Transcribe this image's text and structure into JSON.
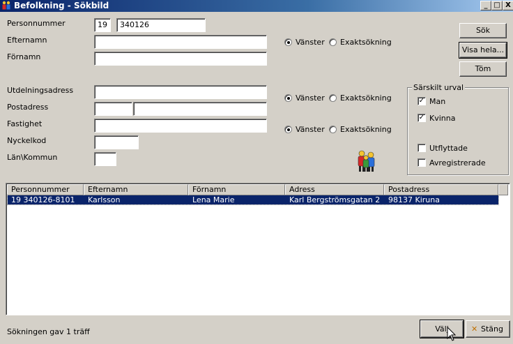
{
  "window": {
    "title": "Befolkning - Sökbild",
    "controls": {
      "minimize": "_",
      "maximize": "□",
      "close": "X"
    }
  },
  "form": {
    "personnummer": {
      "label": "Personnummer",
      "century": "19",
      "value": "340126"
    },
    "efternamn": {
      "label": "Efternamn",
      "value": ""
    },
    "fornamn": {
      "label": "Förnamn",
      "value": ""
    },
    "utdelningsadress": {
      "label": "Utdelningsadress",
      "value": ""
    },
    "postadress": {
      "label": "Postadress",
      "postnummer": "",
      "ort": ""
    },
    "fastighet": {
      "label": "Fastighet",
      "value": ""
    },
    "nyckelkod": {
      "label": "Nyckelkod",
      "value": ""
    },
    "lan_kommun": {
      "label": "Län\\Kommun",
      "value": ""
    }
  },
  "search_options": [
    {
      "left_label": "Vänster",
      "exact_label": "Exaktsökning",
      "selected": "left"
    },
    {
      "left_label": "Vänster",
      "exact_label": "Exaktsökning",
      "selected": "left"
    },
    {
      "left_label": "Vänster",
      "exact_label": "Exaktsökning",
      "selected": "left"
    }
  ],
  "buttons": {
    "sok": "Sök",
    "visa_hela": "Visa hela...",
    "tom": "Töm",
    "valj": "Välj",
    "stang": "Stäng"
  },
  "special_selection": {
    "title": "Särskilt urval",
    "man": {
      "label": "Man",
      "checked": true
    },
    "kvinna": {
      "label": "Kvinna",
      "checked": true
    },
    "utflyttade": {
      "label": "Utflyttade",
      "checked": false
    },
    "avregistrerade": {
      "label": "Avregistrerade",
      "checked": false
    }
  },
  "results": {
    "columns": [
      "Personnummer",
      "Efternamn",
      "Förnamn",
      "Adress",
      "Postadress"
    ],
    "rows": [
      [
        "19 340126-8101",
        "Karlsson",
        "Lena Marie",
        "Karl Bergströmsgatan 2",
        "98137 Kiruna"
      ]
    ]
  },
  "status_text": "Sökningen gav 1 träff",
  "icons": {
    "app": "people-icon",
    "search_people": "people-group-icon",
    "close_x": "x-icon"
  },
  "colors": {
    "titlebar": "#0a246a",
    "selection": "#0a246a",
    "face": "#d4d0c8"
  }
}
